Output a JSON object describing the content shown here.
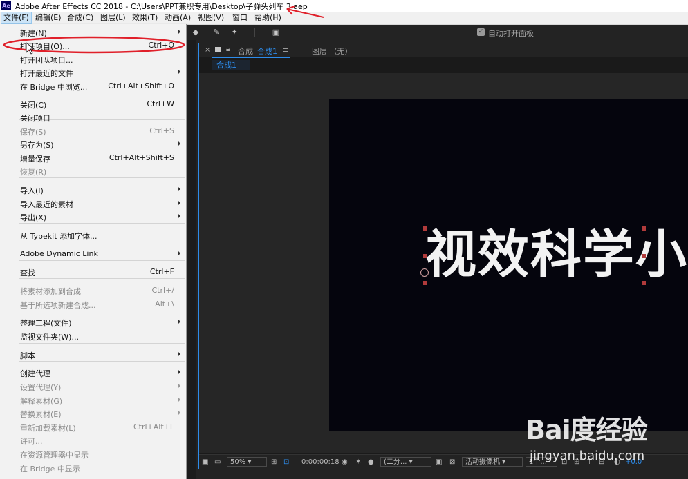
{
  "window": {
    "app_icon": "Ae",
    "title": "Adobe After Effects CC 2018 - C:\\Users\\PPT兼职专用\\Desktop\\子弹头列车 3.aep"
  },
  "menubar": [
    {
      "label": "文件(F)",
      "active": true
    },
    {
      "label": "编辑(E)"
    },
    {
      "label": "合成(C)"
    },
    {
      "label": "图层(L)"
    },
    {
      "label": "效果(T)"
    },
    {
      "label": "动画(A)"
    },
    {
      "label": "视图(V)"
    },
    {
      "label": "窗口"
    },
    {
      "label": "帮助(H)"
    }
  ],
  "file_menu": [
    {
      "label": "新建(N)",
      "submenu": true
    },
    {
      "label": "打开项目(O)...",
      "shortcut": "Ctrl+O",
      "highlighted": true
    },
    {
      "label": "打开团队项目..."
    },
    {
      "label": "打开最近的文件",
      "submenu": true
    },
    {
      "label": "在 Bridge 中浏览...",
      "shortcut": "Ctrl+Alt+Shift+O"
    },
    {
      "label": "关闭(C)",
      "shortcut": "Ctrl+W"
    },
    {
      "label": "关闭项目"
    },
    {
      "label": "保存(S)",
      "shortcut": "Ctrl+S",
      "disabled": true
    },
    {
      "label": "另存为(S)",
      "submenu": true
    },
    {
      "label": "增量保存",
      "shortcut": "Ctrl+Alt+Shift+S"
    },
    {
      "label": "恢复(R)",
      "disabled": true
    },
    {
      "label": "导入(I)",
      "submenu": true
    },
    {
      "label": "导入最近的素材",
      "submenu": true
    },
    {
      "label": "导出(X)",
      "submenu": true
    },
    {
      "label": "从 Typekit 添加字体..."
    },
    {
      "label": "Adobe Dynamic Link",
      "submenu": true
    },
    {
      "label": "查找",
      "shortcut": "Ctrl+F"
    },
    {
      "label": "将素材添加到合成",
      "shortcut": "Ctrl+/",
      "disabled": true
    },
    {
      "label": "基于所选项新建合成...",
      "shortcut": "Alt+\\",
      "disabled": true
    },
    {
      "label": "整理工程(文件)",
      "submenu": true
    },
    {
      "label": "监视文件夹(W)..."
    },
    {
      "label": "脚本",
      "submenu": true
    },
    {
      "label": "创建代理",
      "submenu": true
    },
    {
      "label": "设置代理(Y)",
      "submenu": true,
      "disabled": true
    },
    {
      "label": "解释素材(G)",
      "submenu": true,
      "disabled": true
    },
    {
      "label": "替换素材(E)",
      "submenu": true,
      "disabled": true
    },
    {
      "label": "重新加载素材(L)",
      "shortcut": "Ctrl+Alt+L",
      "disabled": true
    },
    {
      "label": "许可...",
      "disabled": true
    },
    {
      "label": "在资源管理器中显示",
      "disabled": true
    },
    {
      "label": "在 Bridge 中显示",
      "disabled": true
    }
  ],
  "toolbar": {
    "auto_open_panel_label": "自动打开面板",
    "auto_open_checked": true
  },
  "composition_panel": {
    "tab_prefix": "合成",
    "comp_name": "合成1",
    "layer_tab": "图层 （无）",
    "subtab": "合成1",
    "canvas_text": "视效科学小"
  },
  "viewer_controls": {
    "zoom": "50%",
    "timecode": "0:00:00:18",
    "resolution": "(二分...",
    "camera": "活动摄像机",
    "views": "1个...",
    "exposure": "+0.0"
  },
  "watermark": {
    "logo": "Bai度经验",
    "url": "jingyan.baidu.com"
  },
  "colors": {
    "accent": "#2d8ceb",
    "annotation": "#e0202a",
    "menu_bg": "#f2f2f2",
    "panel_bg": "#232323",
    "canvas_bg": "#05050d"
  }
}
